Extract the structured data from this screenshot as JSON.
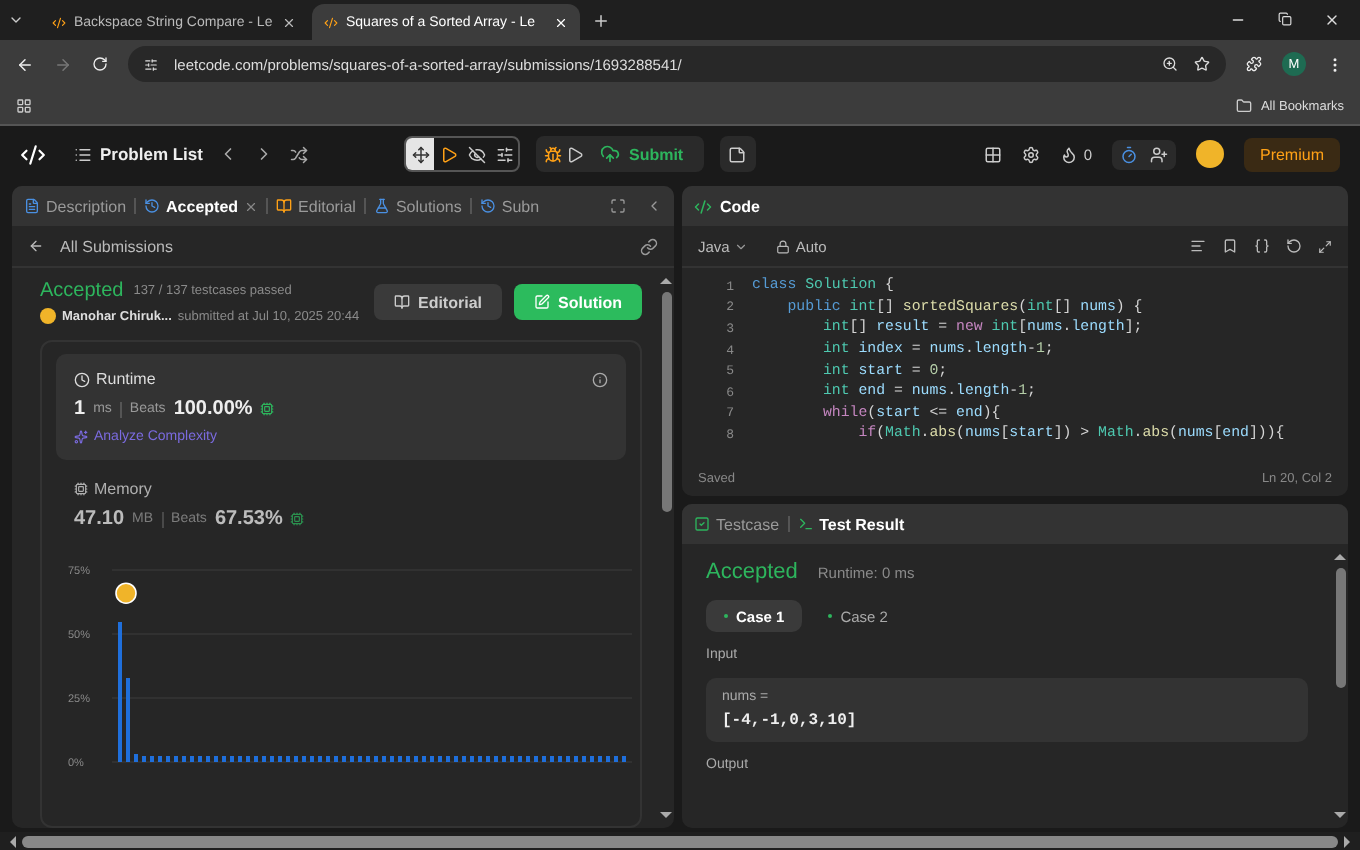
{
  "browser": {
    "tabs": [
      {
        "label": "Backspace String Compare - Le",
        "selected": false
      },
      {
        "label": "Squares of a Sorted Array - Le",
        "selected": true
      }
    ],
    "url": "leetcode.com/problems/squares-of-a-sorted-array/submissions/1693288541/",
    "profile_initial": "M",
    "bookmarks_label": "All Bookmarks"
  },
  "nav": {
    "problem_list": "Problem List",
    "layout_tools": [
      {
        "selected": true
      },
      {
        "selected": false
      },
      {
        "selected": false
      },
      {
        "selected": false
      }
    ],
    "submit": "Submit",
    "streak": "0",
    "premium": "Premium"
  },
  "left_panel": {
    "tabs": [
      {
        "label": "Description",
        "selected": false,
        "closable": false
      },
      {
        "label": "Accepted",
        "selected": true,
        "closable": true
      },
      {
        "label": "Editorial",
        "selected": false,
        "closable": false
      },
      {
        "label": "Solutions",
        "selected": false,
        "closable": false
      },
      {
        "label": "Subn",
        "selected": false,
        "closable": false
      }
    ],
    "back_link": "All Submissions",
    "status": "Accepted",
    "testcases": "137 / 137 testcases passed",
    "author": "Manohar Chiruk...",
    "submitted": "submitted at Jul 10, 2025 20:44",
    "editorial_button": "Editorial",
    "solution_button": "Solution",
    "runtime": {
      "title": "Runtime",
      "value": "1",
      "unit": "ms",
      "beats_label": "Beats",
      "beats": "100.00%",
      "analyze": "Analyze Complexity"
    },
    "memory": {
      "title": "Memory",
      "value": "47.10",
      "unit": "MB",
      "beats_label": "Beats",
      "beats": "67.53%"
    },
    "chart_data": {
      "type": "bar",
      "ylim": [
        0,
        75
      ],
      "yticks": [
        {
          "value": 0,
          "label": "0%"
        },
        {
          "value": 25,
          "label": "25%"
        },
        {
          "value": 50,
          "label": "50%"
        },
        {
          "value": 75,
          "label": "75%"
        }
      ],
      "values": [
        55,
        33,
        3,
        2,
        2,
        2,
        2,
        2,
        2,
        2,
        2,
        2,
        2,
        2,
        2,
        2,
        2,
        2,
        2,
        2,
        2,
        2,
        2,
        2,
        2,
        2,
        2,
        2,
        2,
        2,
        2,
        2,
        2,
        2,
        2,
        2,
        2,
        2,
        2,
        2,
        2,
        2,
        2,
        2,
        2,
        2,
        2,
        2,
        2,
        2,
        2,
        2,
        2,
        2,
        2,
        2,
        2,
        2,
        2,
        2,
        2,
        2,
        2,
        2
      ]
    }
  },
  "code_panel": {
    "title": "Code",
    "language": "Java",
    "mode": "Auto",
    "lines": [
      {
        "n": "1",
        "tokens": [
          {
            "kind": "kw",
            "text": "class "
          },
          {
            "kind": "cls",
            "text": "Solution"
          },
          {
            "kind": "p",
            "text": " {"
          }
        ]
      },
      {
        "n": "2",
        "tokens": [
          {
            "kind": "kw",
            "text": "    public "
          },
          {
            "kind": "ty",
            "text": "int"
          },
          {
            "kind": "p",
            "text": "[] "
          },
          {
            "kind": "fn",
            "text": "sortedSquares"
          },
          {
            "kind": "p",
            "text": "("
          },
          {
            "kind": "ty",
            "text": "int"
          },
          {
            "kind": "p",
            "text": "[] "
          },
          {
            "kind": "v",
            "text": "nums"
          },
          {
            "kind": "p",
            "text": ") {"
          }
        ]
      },
      {
        "n": "3",
        "tokens": [
          {
            "kind": "ty",
            "text": "        int"
          },
          {
            "kind": "p",
            "text": "[] "
          },
          {
            "kind": "v",
            "text": "result"
          },
          {
            "kind": "p",
            "text": " = "
          },
          {
            "kind": "ctl",
            "text": "new "
          },
          {
            "kind": "ty",
            "text": "int"
          },
          {
            "kind": "p",
            "text": "["
          },
          {
            "kind": "v",
            "text": "nums"
          },
          {
            "kind": "p",
            "text": "."
          },
          {
            "kind": "v",
            "text": "length"
          },
          {
            "kind": "p",
            "text": "];"
          }
        ]
      },
      {
        "n": "4",
        "tokens": [
          {
            "kind": "ty",
            "text": "        int "
          },
          {
            "kind": "v",
            "text": "index"
          },
          {
            "kind": "p",
            "text": " = "
          },
          {
            "kind": "v",
            "text": "nums"
          },
          {
            "kind": "p",
            "text": "."
          },
          {
            "kind": "v",
            "text": "length"
          },
          {
            "kind": "p",
            "text": "-"
          },
          {
            "kind": "num",
            "text": "1"
          },
          {
            "kind": "p",
            "text": ";"
          }
        ]
      },
      {
        "n": "5",
        "tokens": [
          {
            "kind": "ty",
            "text": "        int "
          },
          {
            "kind": "v",
            "text": "start"
          },
          {
            "kind": "p",
            "text": " = "
          },
          {
            "kind": "num",
            "text": "0"
          },
          {
            "kind": "p",
            "text": ";"
          }
        ]
      },
      {
        "n": "6",
        "tokens": [
          {
            "kind": "ty",
            "text": "        int "
          },
          {
            "kind": "v",
            "text": "end"
          },
          {
            "kind": "p",
            "text": " = "
          },
          {
            "kind": "v",
            "text": "nums"
          },
          {
            "kind": "p",
            "text": "."
          },
          {
            "kind": "v",
            "text": "length"
          },
          {
            "kind": "p",
            "text": "-"
          },
          {
            "kind": "num",
            "text": "1"
          },
          {
            "kind": "p",
            "text": ";"
          }
        ]
      },
      {
        "n": "7",
        "tokens": [
          {
            "kind": "ctl",
            "text": "        while"
          },
          {
            "kind": "p",
            "text": "("
          },
          {
            "kind": "v",
            "text": "start"
          },
          {
            "kind": "p",
            "text": " <= "
          },
          {
            "kind": "v",
            "text": "end"
          },
          {
            "kind": "p",
            "text": "){"
          }
        ]
      },
      {
        "n": "8",
        "tokens": [
          {
            "kind": "ctl",
            "text": "            if"
          },
          {
            "kind": "p",
            "text": "("
          },
          {
            "kind": "cls",
            "text": "Math"
          },
          {
            "kind": "p",
            "text": "."
          },
          {
            "kind": "fn",
            "text": "abs"
          },
          {
            "kind": "p",
            "text": "("
          },
          {
            "kind": "v",
            "text": "nums"
          },
          {
            "kind": "p",
            "text": "["
          },
          {
            "kind": "v",
            "text": "start"
          },
          {
            "kind": "p",
            "text": "]) > "
          },
          {
            "kind": "cls",
            "text": "Math"
          },
          {
            "kind": "p",
            "text": "."
          },
          {
            "kind": "fn",
            "text": "abs"
          },
          {
            "kind": "p",
            "text": "("
          },
          {
            "kind": "v",
            "text": "nums"
          },
          {
            "kind": "p",
            "text": "["
          },
          {
            "kind": "v",
            "text": "end"
          },
          {
            "kind": "p",
            "text": "])){"
          }
        ]
      }
    ],
    "status": "Saved",
    "cursor": "Ln 20, Col 2"
  },
  "result_panel": {
    "tabs": [
      {
        "label": "Testcase",
        "selected": false
      },
      {
        "label": "Test Result",
        "selected": true
      }
    ],
    "status": "Accepted",
    "runtime": "Runtime: 0 ms",
    "cases": [
      {
        "label": "Case 1",
        "selected": true
      },
      {
        "label": "Case 2",
        "selected": false
      }
    ],
    "input_label": "Input",
    "param": "nums =",
    "param_value": "[-4,-1,0,3,10]",
    "output_label": "Output"
  }
}
